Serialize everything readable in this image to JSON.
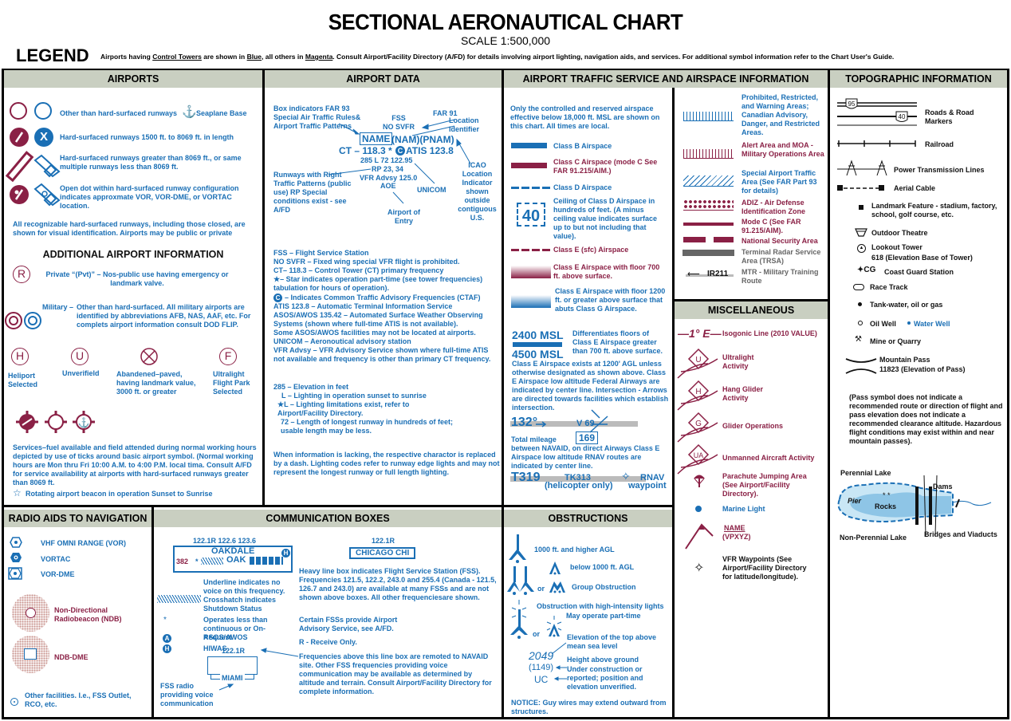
{
  "header": {
    "title": "SECTIONAL AERONAUTICAL CHART",
    "scale": "SCALE 1:500,000",
    "legend": "LEGEND",
    "note_parts": [
      "Airports having ",
      "Control Towers",
      " are shown in ",
      "Blue",
      ", all others in ",
      "Magenta",
      ". Consult Airport/Facility Directory (A/FD) for details involving airport lighting, navigation aids, and services. For additional symbol information refer to the Chart User's Guide."
    ]
  },
  "sections": {
    "airports": "AIRPORTS",
    "airport_data": "AIRPORT DATA",
    "airspace": "AIRPORT TRAFFIC SERVICE AND AIRSPACE INFORMATION",
    "topo": "TOPOGRAPHIC INFORMATION",
    "misc": "MISCELLANEOUS",
    "radio": "RADIO AIDS TO NAVIGATION",
    "comm": "COMMUNICATION BOXES",
    "obstructions": "OBSTRUCTIONS",
    "additional": "ADDITIONAL AIRPORT INFORMATION"
  },
  "airports": {
    "other_than_hard": "Other than hard-surfaced runways",
    "seaplane": "Seaplane Base",
    "hard_1500": "Hard-surfaced runways 1500 ft. to 8069 ft. in length",
    "hard_greater": "Hard-surfaced runways greater than 8069 ft., or same multiple runways less than 8069 ft.",
    "open_dot": "Open dot within hard-surfaced runway configuration indicates approxmate VOR, VOR-DME, or VORTAC location.",
    "recognizable": "All recognizable hard-surfaced runways, including those closed, are shown for visual identification. Airports may be public or private",
    "private": "Private “(Pvt)” – Nos-public use having emergency or landmark valve.",
    "military_label": "Military –",
    "military": "Other than hard-surfaced. All military airports are identified by abbreviations AFB, NAS, AAF, etc. For complets airport information consult DOD FLIP.",
    "heliport": "Heliport Selected",
    "unverified": "Unverifield",
    "abandoned": "Abandened–paved, having landmark value, 3000 ft. or greater",
    "ultralight": "Ultralight Flight Park Selected",
    "services": "Services–fuel available and field attended during normal working hours depicted by use of ticks around basic airport symbol. (Normal working hours are Mon thru Fri 10:00 A.M. to 4:00 P.M. local tima. Consult A/FD for service availability at airports with hard-surfaced runways greater than 8069 ft.",
    "beacon": "Rotating airport beacon in operation Sunset to Sunrise",
    "sym_R": "R",
    "sym_H": "H",
    "sym_U": "U",
    "sym_F": "F"
  },
  "airport_data": {
    "box_indicators": "Box indicators FAR 93 Special Air Traffic Rules& Airport Traffic Patterns",
    "fss": "FSS",
    "no_svfr": "NO SVFR",
    "far91": "FAR 91",
    "location_id": "Location Identifier",
    "name": "NAME",
    "nam": "(NAM)(PNAM)",
    "ct": "CT – 118.3 *",
    "atis": "ATIS  123.8",
    "line285": "285 L 72 122.95",
    "rp": "RP 23, 34",
    "vfr_advsy": "VFR Advsy 125.0",
    "aoe": "AOE",
    "runways_right": "Runways with Right Traffic Patterns (public use) RP   Special conditions exist - see A/FD",
    "unicom": "UNICOM",
    "airport_entry": "Airport of Entry",
    "icao": "ICAO Location Indicator shown outside contiguous U.S.",
    "desc": [
      "FSS – Flight Service Station",
      "NO SVFR – Fixed wing special VFR flight is prohibited.",
      "CT– 118.3 – Control Tower (CT) primary frequency",
      "★– Star indicates operation part-time (see tower frequencies) tabulation for hours of operation).",
      "– Indicates Common Traffic Advisory Frequencies (CTAF)",
      "ATIS 123.8 – Automatic Terminal Information Service",
      "ASOS/AWOS 135.42 – Automated Surface Weather Observing Systems (shown where full-time ATIS is not available).",
      "Some ASOS/AWOS facilities may not be located at airports.",
      "UNICOM – Aeronoutical advisory station",
      "VFR Advsy – VFR Advisory Service shown where full-time ATIS not available and frequency is other than primary CT frequency."
    ],
    "elev": [
      "285 – Elevation in feet",
      "L – Lighting in operation sunset to sunrise",
      "★L – Lighting limitations exist, refer to Airport/Facility Directory.",
      "72 – Length of longest runway in hundreds of feet; usable length may be less."
    ],
    "lacking": "When information is lacking, the respective charactor is replaced by a dash. Lighting codes refer to runway edge lights and may not represent the longest runway or full length lighting."
  },
  "airspace": {
    "intro": "Only the controlled and reserved airspace effective below 18,000 ft. MSL are shown on this chart. All times are local.",
    "class_b": "Class B Airspace",
    "class_c": "Class C Airspace (mode C See FAR 91.215/AIM.)",
    "class_d": "Class D Airspace",
    "ceiling_val": "40",
    "ceiling": "Ceiling of Class D Airspace in hundreds of feet. (A minus ceiling value indicates surface up to but not including that value).",
    "class_e_sfc": "Class E (sfc) Airspace",
    "class_e_700": "Class E Airspace with floor 700 ft. above surface.",
    "class_e_1200": "Class E Airspace with floor 1200 ft. or greater above surface that abuts Class G Airspace.",
    "msl_2400": "2400 MSL",
    "msl_4500": "4500 MSL",
    "differentiates": "Differentiates floors of Class E Airspace greater than 700 ft. above surface.",
    "class_e_exists": "Class E Airspace exists at 1200' AGL unless otherwise designated as shown above. Class E Airspace low altitude Federal Airways are indicated by center line. Intersection - Arrows are directed towards facilities which establish intersection.",
    "deg": "132°",
    "v69": "V 69",
    "total_mileage": "Total mileage",
    "mileage_val": "169",
    "between": "between NAVAID, on direct Airways Class E Airspace low altitude RNAV routes are indicated by center line.",
    "t319": "T319",
    "tk313": "TK313",
    "heli_only": "(helicopter only)",
    "rnav": "RNAV",
    "waypoint": "waypoint",
    "prohibited": "Prohibited, Restricted, and Warning Areas; Canadian Advisory, Danger, and Restricted Areas.",
    "alert": "Alert Area and MOA - Military Operations Area",
    "special": "Special Airport Traffic Area (See FAR Part 93 for details)",
    "adiz": "ADIZ - Air Defense Identification Zone",
    "mode_c": "Mode C (See FAR 91.215/AIM).",
    "nsa": "National Security Area",
    "trsa": "Terminal Radar Service Area (TRSA)",
    "ir211": "IR211",
    "mtr": "MTR - Military Training Route"
  },
  "misc": {
    "isogonic_sym": "1° E",
    "isogonic": "Isogonic Line (2010 VALUE)",
    "ultralight": "Ultralight Activity",
    "hang_glider": "Hang Glider Activity",
    "glider": "Glider Operations",
    "unmanned": "Unmanned Aircraft Activity",
    "parachute": "Parachute Jumping Area (See Airport/Facility Directory).",
    "marine": "Marine Light",
    "name": "NAME",
    "vpxyz": "(VPXYZ)",
    "vfr_wp": "VFR Waypoints (See Airport/Facility Directory for latitude/longitude).",
    "sym_U": "U",
    "sym_H": "H",
    "sym_G": "G",
    "sym_UA": "UA"
  },
  "topo": {
    "road_95": "95",
    "road_40": "40",
    "roads": "Roads & Road Markers",
    "railroad": "Railroad",
    "power": "Power Transmission Lines",
    "aerial": "Aerial Cable",
    "landmark": "Landmark Feature - stadium, factory, school, golf course, etc.",
    "theatre": "Outdoor Theatre",
    "lookout": "Lookout Tower",
    "lookout_elev": "618 (Elevation Base of Tower)",
    "cg_sym": "CG",
    "coast_guard": "Coast Guard Station",
    "race": "Race Track",
    "tank": "Tank-water, oil or gas",
    "oil": "Oil Well",
    "water": "Water Well",
    "mine": "Mine or Quarry",
    "pass": "Mountain Pass",
    "pass_elev": "11823 (Elevation of Pass)",
    "pass_note": "(Pass symbol does not indicate a recommended route or direction of flight and pass elevation does not indicate a recommended clearance altitude. Hazardous flight conditions may exist within and near mountain passes).",
    "perennial": "Perennial Lake",
    "dams": "Dams",
    "pier": "Pier",
    "rocks": "Rocks",
    "non_perennial": "Non-Perennial Lake",
    "bridges": "Bridges and Viaducts"
  },
  "radio": {
    "vor": "VHF OMNI RANGE (VOR)",
    "vortac": "VORTAC",
    "vordme": "VOR-DME",
    "ndb": "Non-Directional Radiobeacon (NDB)",
    "ndbdme": "NDB-DME",
    "other": "Other facilities. I.e., FSS Outlet, RCO, etc."
  },
  "comm": {
    "freqs": "122.1R 122.6  123.6",
    "oakdale": "OAKDALE",
    "n382": "382",
    "oak": "OAK",
    "underline": "Underline indicates no voice on this frequency.",
    "crosshatch": "Crosshatch indicates Shutdown Status",
    "operates": "Operates less than continuous or On-Request.",
    "asos": "ASOS/AWOS",
    "hiwas": "HIWAS",
    "f1221r": "122.1R",
    "miami": "MIAMI",
    "fss_radio": "FSS radio providing voice communication",
    "chicago_freq": "122.1R",
    "chicago": "CHICAGO CHI",
    "heavy": "Heavy line box indicates Flight Service Station (FSS). Frequencies 121.5, 122.2, 243.0 and 255.4 (Canada - 121.5, 126.7 and 243.0) are available at many FSSs and are not shown above boxes. All other frequenciesare shown.",
    "certain": "Certain FSSs provide Airport Advisory Service, see A/FD.",
    "receive": "R - Receive Only.",
    "remoted": "Frequencies above this line box are remoted to NAVAID site. Other FSS frequencies providing voice communication may be available as determined by altitude and terrain. Consult Airport/Facility Directory for complete information.",
    "sym_A": "A",
    "sym_H": "H"
  },
  "obstructions": {
    "o1000": "1000 ft. and higher AGL",
    "below": "below 1000 ft. AGL",
    "or": "or",
    "group": "Group Obstruction",
    "high_int": "Obstruction with high-intensity lights",
    "part_time": "May operate part-time",
    "elev_top": "Elevation of the top above mean sea level",
    "v2049": "2049",
    "v1149": "(1149)",
    "uc": "UC",
    "height": "Height above ground",
    "under": "Under construction or reported; position and elevation unverified.",
    "notice": "NOTICE: Guy wires may extend outward from structures."
  }
}
